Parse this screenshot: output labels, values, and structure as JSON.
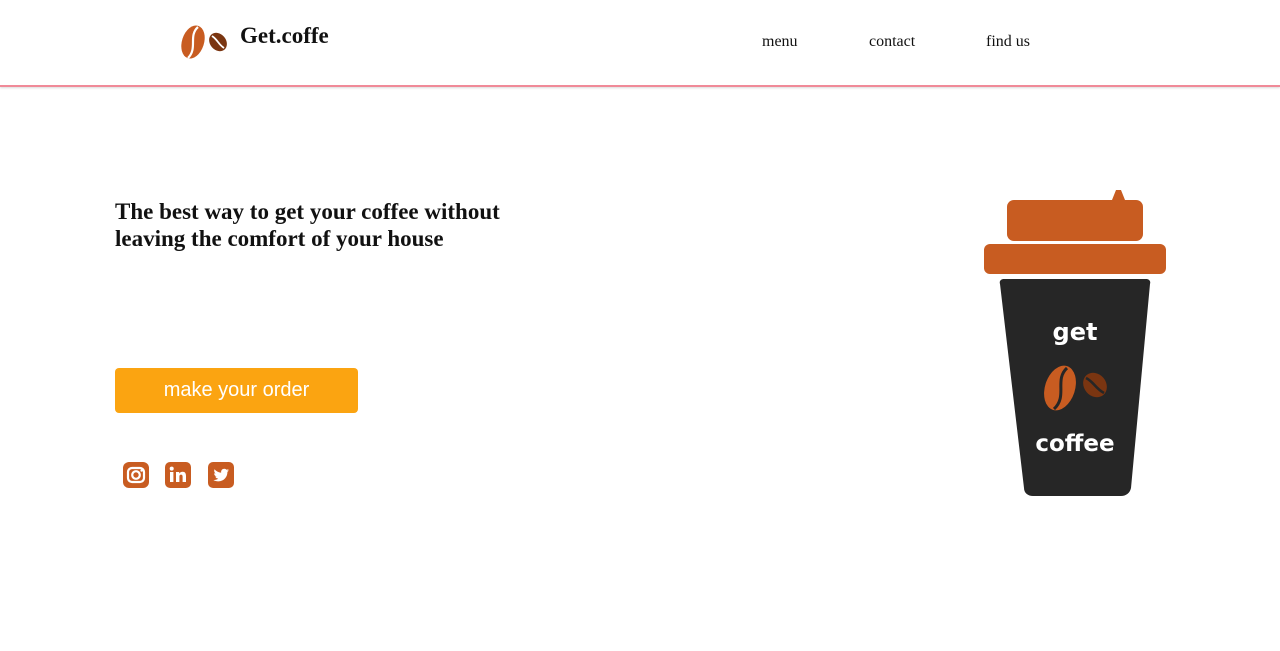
{
  "header": {
    "brand": "Get.coffe",
    "logo_icon": "coffee-beans-icon",
    "nav": [
      {
        "label": "menu"
      },
      {
        "label": "contact"
      },
      {
        "label": "find us"
      }
    ]
  },
  "hero": {
    "title": "The best way to get your coffee without leaving the comfort of your house",
    "cta_label": "make your order",
    "social_icons": [
      "instagram-icon",
      "linkedin-icon",
      "twitter-icon"
    ]
  },
  "illustration": {
    "cup_top_text": "get",
    "cup_bottom_text": "coffee"
  },
  "colors": {
    "accent_orange": "#c85c21",
    "bean_dark": "#7a3511",
    "cta_yellow": "#fba411",
    "cup_dark": "#262626",
    "header_border": "#f08a98"
  }
}
